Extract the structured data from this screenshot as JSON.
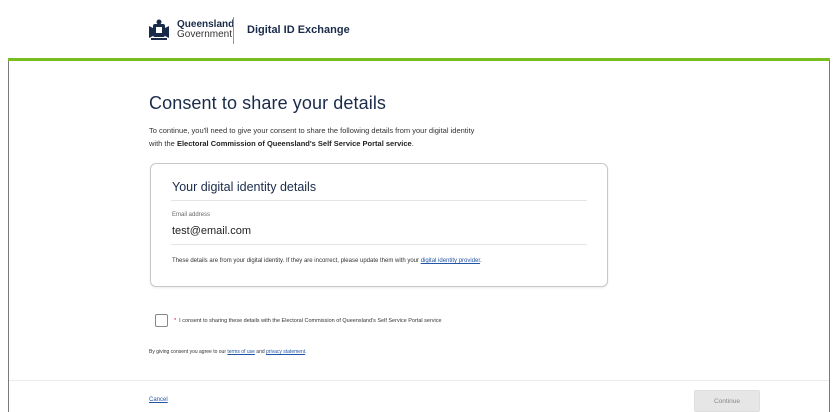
{
  "header": {
    "brand_line1": "Queensland",
    "brand_line2": "Government",
    "app_title": "Digital ID Exchange",
    "logo_icon": "coat-of-arms-icon"
  },
  "page": {
    "title": "Consent to share your details",
    "intro_text": "To continue, you'll need to give your consent to share the following details from your digital identity with the ",
    "intro_bold": "Electoral Commission of Queensland's Self Service Portal service",
    "intro_end": "."
  },
  "details_card": {
    "title": "Your digital identity details",
    "field_label": "Email address",
    "field_value": "test@email.com",
    "note_text": "These details are from your digital identity. If they are incorrect, please update them with your ",
    "note_link": "digital identity provider",
    "note_end": "."
  },
  "consent": {
    "required_marker": "*",
    "label": "I consent to sharing these details with the Electoral Commission of Queensland's Self Service Portal service",
    "checked": false
  },
  "agreement": {
    "prefix": "By giving consent you agree to our ",
    "terms_link": "terms of use",
    "and": " and ",
    "privacy_link": "privacy statement",
    "suffix": "."
  },
  "footer": {
    "cancel_label": "Cancel",
    "continue_label": "Continue"
  },
  "colors": {
    "accent_green": "#78be20",
    "heading_navy": "#1a2b4a",
    "link_blue": "#2155a5"
  }
}
